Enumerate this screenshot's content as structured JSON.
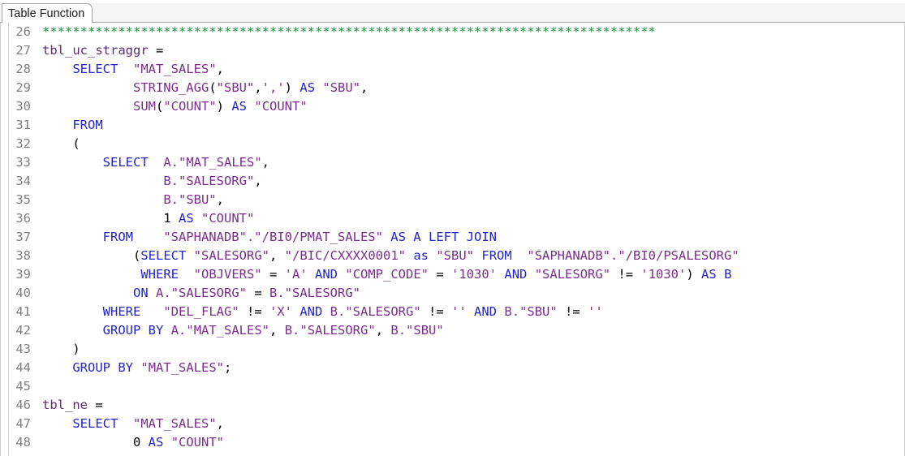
{
  "window": {
    "tab_label": "Table Function"
  },
  "editor": {
    "first_line_number": 26,
    "colors": {
      "keyword": "#2323c8",
      "string": "#7b2d8e",
      "comment": "#1d9141",
      "identifier": "#5c2d74",
      "plain": "#000000",
      "line_number": "#808080",
      "background": "#ffffff"
    },
    "lines": [
      {
        "number": "26",
        "tokens": [
          {
            "t": "*********************************************************************************",
            "c": "comment"
          }
        ]
      },
      {
        "number": "27",
        "tokens": [
          {
            "t": "tbl_uc_straggr",
            "c": "ident"
          },
          {
            "t": " ",
            "c": "plain"
          },
          {
            "t": "=",
            "c": "plain"
          }
        ]
      },
      {
        "number": "28",
        "tokens": [
          {
            "t": "    ",
            "c": "plain"
          },
          {
            "t": "SELECT",
            "c": "kw"
          },
          {
            "t": "  ",
            "c": "plain"
          },
          {
            "t": "\"MAT_SALES\"",
            "c": "str"
          },
          {
            "t": ",",
            "c": "plain"
          }
        ]
      },
      {
        "number": "29",
        "tokens": [
          {
            "t": "            ",
            "c": "plain"
          },
          {
            "t": "STRING_AGG",
            "c": "str"
          },
          {
            "t": "(",
            "c": "plain"
          },
          {
            "t": "\"SBU\"",
            "c": "str"
          },
          {
            "t": ",",
            "c": "plain"
          },
          {
            "t": "','",
            "c": "str"
          },
          {
            "t": ")",
            "c": "plain"
          },
          {
            "t": " ",
            "c": "plain"
          },
          {
            "t": "AS",
            "c": "kw"
          },
          {
            "t": " ",
            "c": "plain"
          },
          {
            "t": "\"SBU\"",
            "c": "str"
          },
          {
            "t": ",",
            "c": "plain"
          }
        ]
      },
      {
        "number": "30",
        "tokens": [
          {
            "t": "            ",
            "c": "plain"
          },
          {
            "t": "SUM",
            "c": "str"
          },
          {
            "t": "(",
            "c": "plain"
          },
          {
            "t": "\"COUNT\"",
            "c": "str"
          },
          {
            "t": ")",
            "c": "plain"
          },
          {
            "t": " ",
            "c": "plain"
          },
          {
            "t": "AS",
            "c": "kw"
          },
          {
            "t": " ",
            "c": "plain"
          },
          {
            "t": "\"COUNT\"",
            "c": "str"
          }
        ]
      },
      {
        "number": "31",
        "tokens": [
          {
            "t": "    ",
            "c": "plain"
          },
          {
            "t": "FROM",
            "c": "kw"
          }
        ]
      },
      {
        "number": "32",
        "tokens": [
          {
            "t": "    ",
            "c": "plain"
          },
          {
            "t": "(",
            "c": "plain"
          }
        ]
      },
      {
        "number": "33",
        "tokens": [
          {
            "t": "        ",
            "c": "plain"
          },
          {
            "t": "SELECT",
            "c": "kw"
          },
          {
            "t": "  ",
            "c": "plain"
          },
          {
            "t": "A.",
            "c": "str"
          },
          {
            "t": "\"MAT_SALES\"",
            "c": "str"
          },
          {
            "t": ",",
            "c": "plain"
          }
        ]
      },
      {
        "number": "34",
        "tokens": [
          {
            "t": "                ",
            "c": "plain"
          },
          {
            "t": "B.",
            "c": "str"
          },
          {
            "t": "\"SALESORG\"",
            "c": "str"
          },
          {
            "t": ",",
            "c": "plain"
          }
        ]
      },
      {
        "number": "35",
        "tokens": [
          {
            "t": "                ",
            "c": "plain"
          },
          {
            "t": "B.",
            "c": "str"
          },
          {
            "t": "\"SBU\"",
            "c": "str"
          },
          {
            "t": ",",
            "c": "plain"
          }
        ]
      },
      {
        "number": "36",
        "tokens": [
          {
            "t": "                ",
            "c": "plain"
          },
          {
            "t": "1",
            "c": "num"
          },
          {
            "t": " ",
            "c": "plain"
          },
          {
            "t": "AS",
            "c": "kw"
          },
          {
            "t": " ",
            "c": "plain"
          },
          {
            "t": "\"COUNT\"",
            "c": "str"
          }
        ]
      },
      {
        "number": "37",
        "tokens": [
          {
            "t": "        ",
            "c": "plain"
          },
          {
            "t": "FROM",
            "c": "kw"
          },
          {
            "t": "    ",
            "c": "plain"
          },
          {
            "t": "\"SAPHANADB\".\"/BI0/PMAT_SALES\"",
            "c": "str"
          },
          {
            "t": " ",
            "c": "plain"
          },
          {
            "t": "AS",
            "c": "kw"
          },
          {
            "t": " ",
            "c": "plain"
          },
          {
            "t": "A",
            "c": "kw"
          },
          {
            "t": " ",
            "c": "plain"
          },
          {
            "t": "LEFT",
            "c": "kw"
          },
          {
            "t": " ",
            "c": "plain"
          },
          {
            "t": "JOIN",
            "c": "kw"
          }
        ]
      },
      {
        "number": "38",
        "tokens": [
          {
            "t": "            ",
            "c": "plain"
          },
          {
            "t": "(",
            "c": "plain"
          },
          {
            "t": "SELECT",
            "c": "kw"
          },
          {
            "t": " ",
            "c": "plain"
          },
          {
            "t": "\"SALESORG\"",
            "c": "str"
          },
          {
            "t": ", ",
            "c": "plain"
          },
          {
            "t": "\"/BIC/CXXXX0001\"",
            "c": "str"
          },
          {
            "t": " ",
            "c": "plain"
          },
          {
            "t": "as",
            "c": "kw"
          },
          {
            "t": " ",
            "c": "plain"
          },
          {
            "t": "\"SBU\"",
            "c": "str"
          },
          {
            "t": " ",
            "c": "plain"
          },
          {
            "t": "FROM",
            "c": "kw"
          },
          {
            "t": "  ",
            "c": "plain"
          },
          {
            "t": "\"SAPHANADB\".\"/BI0/PSALESORG\"",
            "c": "str"
          }
        ]
      },
      {
        "number": "39",
        "tokens": [
          {
            "t": "             ",
            "c": "plain"
          },
          {
            "t": "WHERE",
            "c": "kw"
          },
          {
            "t": "  ",
            "c": "plain"
          },
          {
            "t": "\"OBJVERS\"",
            "c": "str"
          },
          {
            "t": " = ",
            "c": "plain"
          },
          {
            "t": "'A'",
            "c": "str"
          },
          {
            "t": " ",
            "c": "plain"
          },
          {
            "t": "AND",
            "c": "kw"
          },
          {
            "t": " ",
            "c": "plain"
          },
          {
            "t": "\"COMP_CODE\"",
            "c": "str"
          },
          {
            "t": " = ",
            "c": "plain"
          },
          {
            "t": "'1030'",
            "c": "str"
          },
          {
            "t": " ",
            "c": "plain"
          },
          {
            "t": "AND",
            "c": "kw"
          },
          {
            "t": " ",
            "c": "plain"
          },
          {
            "t": "\"SALESORG\"",
            "c": "str"
          },
          {
            "t": " != ",
            "c": "plain"
          },
          {
            "t": "'1030'",
            "c": "str"
          },
          {
            "t": ")",
            "c": "plain"
          },
          {
            "t": " ",
            "c": "plain"
          },
          {
            "t": "AS",
            "c": "kw"
          },
          {
            "t": " ",
            "c": "plain"
          },
          {
            "t": "B",
            "c": "kw"
          }
        ]
      },
      {
        "number": "40",
        "tokens": [
          {
            "t": "            ",
            "c": "plain"
          },
          {
            "t": "ON",
            "c": "kw"
          },
          {
            "t": " ",
            "c": "plain"
          },
          {
            "t": "A.",
            "c": "str"
          },
          {
            "t": "\"SALESORG\"",
            "c": "str"
          },
          {
            "t": " = ",
            "c": "plain"
          },
          {
            "t": "B.",
            "c": "str"
          },
          {
            "t": "\"SALESORG\"",
            "c": "str"
          }
        ]
      },
      {
        "number": "41",
        "tokens": [
          {
            "t": "        ",
            "c": "plain"
          },
          {
            "t": "WHERE",
            "c": "kw"
          },
          {
            "t": "   ",
            "c": "plain"
          },
          {
            "t": "\"DEL_FLAG\"",
            "c": "str"
          },
          {
            "t": " != ",
            "c": "plain"
          },
          {
            "t": "'X'",
            "c": "str"
          },
          {
            "t": " ",
            "c": "plain"
          },
          {
            "t": "AND",
            "c": "kw"
          },
          {
            "t": " ",
            "c": "plain"
          },
          {
            "t": "B.",
            "c": "str"
          },
          {
            "t": "\"SALESORG\"",
            "c": "str"
          },
          {
            "t": " != ",
            "c": "plain"
          },
          {
            "t": "''",
            "c": "str"
          },
          {
            "t": " ",
            "c": "plain"
          },
          {
            "t": "AND",
            "c": "kw"
          },
          {
            "t": " ",
            "c": "plain"
          },
          {
            "t": "B.",
            "c": "str"
          },
          {
            "t": "\"SBU\"",
            "c": "str"
          },
          {
            "t": " != ",
            "c": "plain"
          },
          {
            "t": "''",
            "c": "str"
          }
        ]
      },
      {
        "number": "42",
        "tokens": [
          {
            "t": "        ",
            "c": "plain"
          },
          {
            "t": "GROUP",
            "c": "kw"
          },
          {
            "t": " ",
            "c": "plain"
          },
          {
            "t": "BY",
            "c": "kw"
          },
          {
            "t": " ",
            "c": "plain"
          },
          {
            "t": "A.",
            "c": "str"
          },
          {
            "t": "\"MAT_SALES\"",
            "c": "str"
          },
          {
            "t": ", ",
            "c": "plain"
          },
          {
            "t": "B.",
            "c": "str"
          },
          {
            "t": "\"SALESORG\"",
            "c": "str"
          },
          {
            "t": ", ",
            "c": "plain"
          },
          {
            "t": "B.",
            "c": "str"
          },
          {
            "t": "\"SBU\"",
            "c": "str"
          }
        ]
      },
      {
        "number": "43",
        "tokens": [
          {
            "t": "    ",
            "c": "plain"
          },
          {
            "t": ")",
            "c": "plain"
          }
        ]
      },
      {
        "number": "44",
        "tokens": [
          {
            "t": "    ",
            "c": "plain"
          },
          {
            "t": "GROUP",
            "c": "kw"
          },
          {
            "t": " ",
            "c": "plain"
          },
          {
            "t": "BY",
            "c": "kw"
          },
          {
            "t": " ",
            "c": "plain"
          },
          {
            "t": "\"MAT_SALES\"",
            "c": "str"
          },
          {
            "t": ";",
            "c": "plain"
          }
        ]
      },
      {
        "number": "45",
        "tokens": []
      },
      {
        "number": "46",
        "tokens": [
          {
            "t": "tbl_ne",
            "c": "ident"
          },
          {
            "t": " ",
            "c": "plain"
          },
          {
            "t": "=",
            "c": "plain"
          }
        ]
      },
      {
        "number": "47",
        "tokens": [
          {
            "t": "    ",
            "c": "plain"
          },
          {
            "t": "SELECT",
            "c": "kw"
          },
          {
            "t": "  ",
            "c": "plain"
          },
          {
            "t": "\"MAT_SALES\"",
            "c": "str"
          },
          {
            "t": ",",
            "c": "plain"
          }
        ]
      },
      {
        "number": "48",
        "tokens": [
          {
            "t": "            ",
            "c": "plain"
          },
          {
            "t": "0",
            "c": "num"
          },
          {
            "t": " ",
            "c": "plain"
          },
          {
            "t": "AS",
            "c": "kw"
          },
          {
            "t": " ",
            "c": "plain"
          },
          {
            "t": "\"COUNT\"",
            "c": "str"
          }
        ]
      }
    ]
  }
}
